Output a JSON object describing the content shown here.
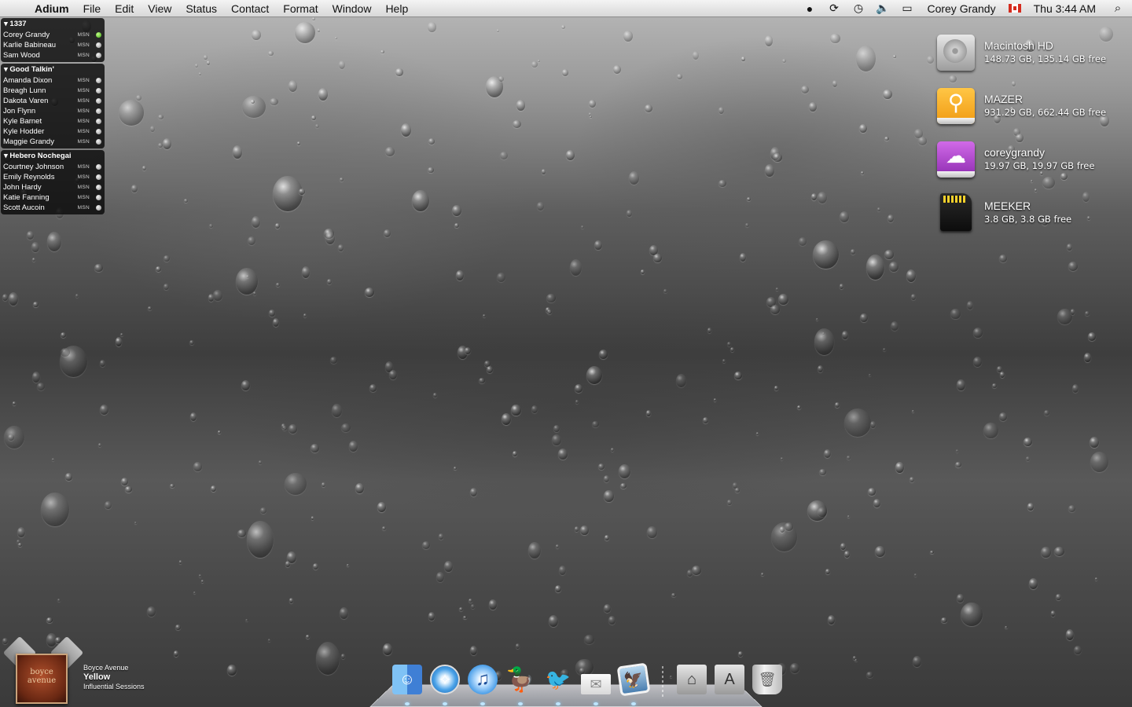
{
  "menubar": {
    "app_name": "Adium",
    "menus": [
      "File",
      "Edit",
      "View",
      "Status",
      "Contact",
      "Format",
      "Window",
      "Help"
    ],
    "status_icons": [
      "record-icon",
      "sync-icon",
      "time-machine-icon",
      "volume-icon",
      "battery-icon"
    ],
    "user_name": "Corey Grandy",
    "clock": "Thu 3:44 AM"
  },
  "contact_groups": [
    {
      "name": "1337",
      "contacts": [
        {
          "name": "Corey Grandy",
          "service": "MSN",
          "status": "online"
        },
        {
          "name": "Karlie Babineau",
          "service": "MSN",
          "status": "offline"
        },
        {
          "name": "Sam Wood",
          "service": "MSN",
          "status": "offline"
        }
      ]
    },
    {
      "name": "Good Talkin'",
      "contacts": [
        {
          "name": "Amanda Dixon",
          "service": "MSN",
          "status": "offline"
        },
        {
          "name": "Breagh Lunn",
          "service": "MSN",
          "status": "offline"
        },
        {
          "name": "Dakota Varen",
          "service": "MSN",
          "status": "offline"
        },
        {
          "name": "Jon Flynn",
          "service": "MSN",
          "status": "offline"
        },
        {
          "name": "Kyle Barnet",
          "service": "MSN",
          "status": "offline"
        },
        {
          "name": "Kyle Hodder",
          "service": "MSN",
          "status": "offline"
        },
        {
          "name": "Maggie Grandy",
          "service": "MSN",
          "status": "offline"
        }
      ]
    },
    {
      "name": "Hebero Nochegai",
      "contacts": [
        {
          "name": "Courtney Johnson",
          "service": "MSN",
          "status": "offline"
        },
        {
          "name": "Emily Reynolds",
          "service": "MSN",
          "status": "offline"
        },
        {
          "name": "John Hardy",
          "service": "MSN",
          "status": "offline"
        },
        {
          "name": "Katie Fanning",
          "service": "MSN",
          "status": "offline"
        },
        {
          "name": "Scott Aucoin",
          "service": "MSN",
          "status": "offline"
        }
      ]
    }
  ],
  "volumes": [
    {
      "name": "Macintosh HD",
      "info": "148.73 GB, 135.14 GB free",
      "icon": "hard-drive-icon"
    },
    {
      "name": "MAZER",
      "info": "931.29 GB, 662.44 GB free",
      "icon": "usb-drive-icon"
    },
    {
      "name": "coreygrandy",
      "info": "19.97 GB, 19.97 GB free",
      "icon": "cloud-drive-icon"
    },
    {
      "name": "MEEKER",
      "info": "3.8 GB, 3.8 GB free",
      "icon": "sd-card-icon"
    }
  ],
  "now_playing": {
    "artist": "Boyce Avenue",
    "title": "Yellow",
    "album": "Influential Sessions",
    "album_art_text": "boyce avenue"
  },
  "dock": {
    "apps": [
      "finder-icon",
      "safari-icon",
      "itunes-icon",
      "adium-icon",
      "twitter-icon",
      "mail-icon",
      "preview-icon"
    ],
    "stacks": [
      "home-stack-icon",
      "applications-stack-icon",
      "trash-icon"
    ]
  }
}
